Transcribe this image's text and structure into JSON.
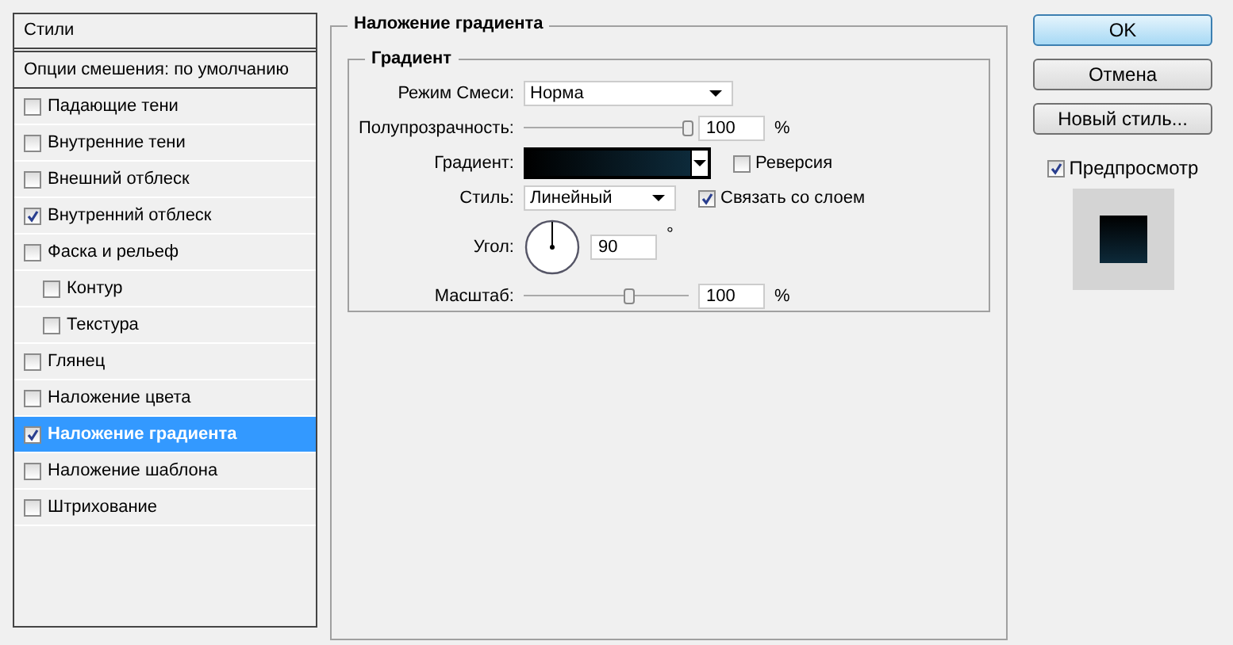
{
  "styles_panel": {
    "title": "Стили",
    "blend_options": "Опции смешения: по умолчанию",
    "items": [
      {
        "label": "Падающие тени",
        "checked": false,
        "selected": false
      },
      {
        "label": "Внутренние тени",
        "checked": false,
        "selected": false
      },
      {
        "label": "Внешний отблеск",
        "checked": false,
        "selected": false
      },
      {
        "label": "Внутренний отблеск",
        "checked": true,
        "selected": false
      },
      {
        "label": "Фаска и рельеф",
        "checked": false,
        "selected": false,
        "children": [
          {
            "label": "Контур",
            "checked": false,
            "selected": false
          },
          {
            "label": "Текстура",
            "checked": false,
            "selected": false
          }
        ]
      },
      {
        "label": "Глянец",
        "checked": false,
        "selected": false
      },
      {
        "label": "Наложение цвета",
        "checked": false,
        "selected": false
      },
      {
        "label": "Наложение градиента",
        "checked": true,
        "selected": true
      },
      {
        "label": "Наложение шаблона",
        "checked": false,
        "selected": false
      },
      {
        "label": "Штрихование",
        "checked": false,
        "selected": false
      }
    ]
  },
  "section": {
    "title": "Наложение градиента",
    "group": "Градиент",
    "blend_mode": {
      "label": "Режим Смеси:",
      "value": "Норма"
    },
    "opacity": {
      "label": "Полупрозрачность:",
      "level": 1,
      "value": "100",
      "unit": "%"
    },
    "gradient": {
      "label": "Градиент:",
      "reverse": {
        "label": "Реверсия",
        "checked": false
      }
    },
    "style": {
      "label": "Стиль:",
      "value": "Линейный",
      "align": {
        "label": "Связать со слоем",
        "checked": true
      }
    },
    "angle": {
      "label": "Угол:",
      "value": "90",
      "unit": "°"
    },
    "scale": {
      "label": "Масштаб:",
      "level": 0.64,
      "value": "100",
      "unit": "%"
    }
  },
  "buttons": [
    {
      "label": "OK",
      "default": true
    },
    {
      "label": "Отмена",
      "default": false
    },
    {
      "label": "Новый стиль...",
      "default": false
    }
  ],
  "preview": {
    "label": "Предпросмотр",
    "checked": true
  }
}
